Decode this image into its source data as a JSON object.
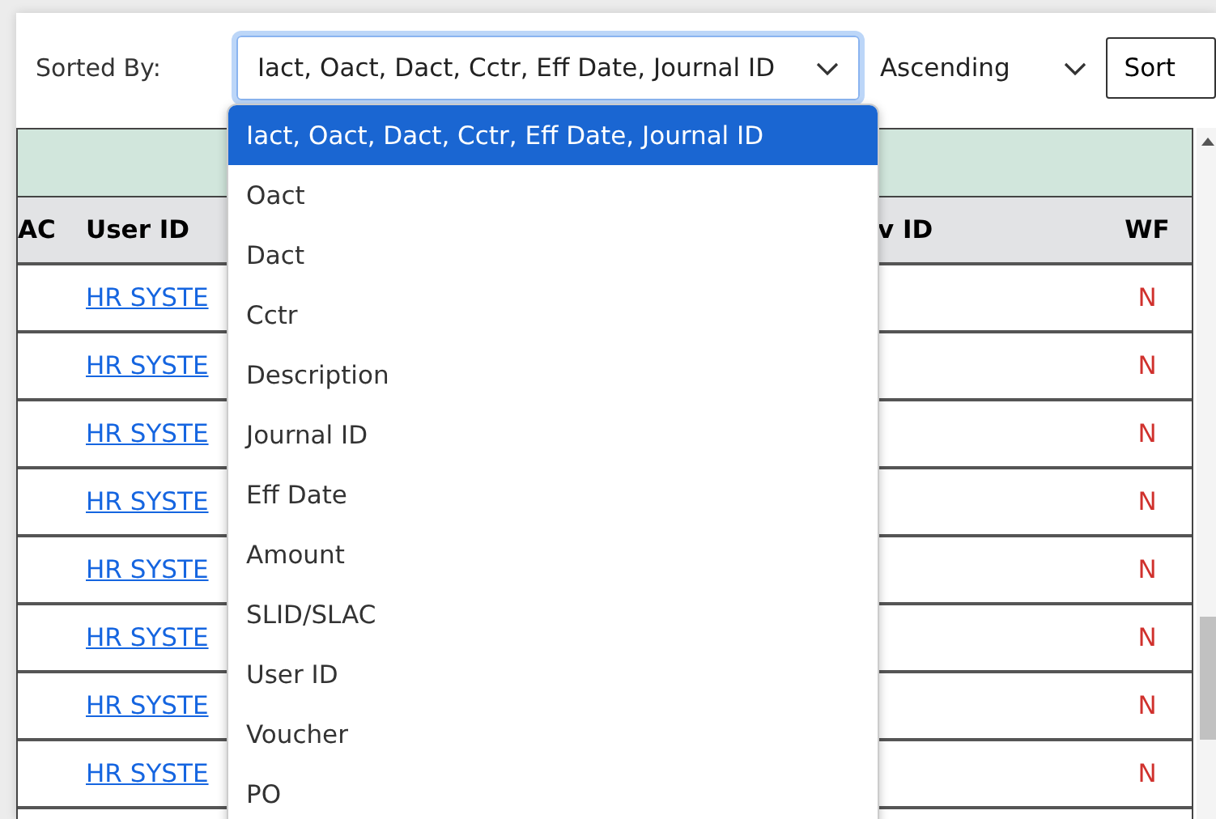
{
  "toolbar": {
    "sort_label": "Sorted By:",
    "sort_field": {
      "value": "Iact, Oact, Dact, Cctr, Eff Date, Journal ID",
      "focused": true
    },
    "order": {
      "value": "Ascending"
    },
    "sort_button": "Sort"
  },
  "table": {
    "columns": [
      "AC",
      "User ID",
      "v ID",
      "WF"
    ],
    "rows": [
      {
        "user_id": "HR SYSTE",
        "wf": "N"
      },
      {
        "user_id": "HR SYSTE",
        "wf": "N"
      },
      {
        "user_id": "HR SYSTE",
        "wf": "N"
      },
      {
        "user_id": "HR SYSTE",
        "wf": "N"
      },
      {
        "user_id": "HR SYSTE",
        "wf": "N"
      },
      {
        "user_id": "HR SYSTE",
        "wf": "N"
      },
      {
        "user_id": "HR SYSTE",
        "wf": "N"
      },
      {
        "user_id": "HR SYSTE",
        "wf": "N"
      }
    ]
  },
  "dropdown": {
    "options": [
      {
        "label": "Iact, Oact, Dact, Cctr, Eff Date, Journal ID",
        "selected": true
      },
      {
        "label": "Oact",
        "selected": false
      },
      {
        "label": "Dact",
        "selected": false
      },
      {
        "label": "Cctr",
        "selected": false
      },
      {
        "label": "Description",
        "selected": false
      },
      {
        "label": "Journal ID",
        "selected": false
      },
      {
        "label": "Eff Date",
        "selected": false
      },
      {
        "label": "Amount",
        "selected": false
      },
      {
        "label": "SLID/SLAC",
        "selected": false
      },
      {
        "label": "User ID",
        "selected": false
      },
      {
        "label": "Voucher",
        "selected": false
      },
      {
        "label": "PO",
        "selected": false
      }
    ]
  }
}
